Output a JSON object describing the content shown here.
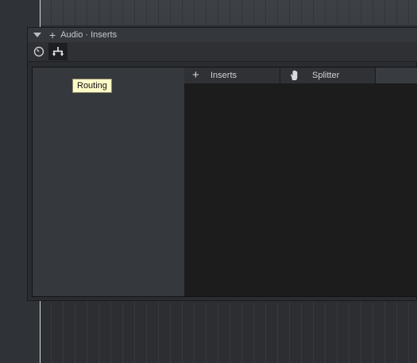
{
  "panel": {
    "title": "Audio · Inserts",
    "collapse_icon": "triangle-down-icon",
    "add_icon": "plus-icon"
  },
  "toolbar": {
    "buttons": [
      {
        "icon": "gauge-icon",
        "active": false
      },
      {
        "icon": "routing-icon",
        "active": true
      }
    ]
  },
  "tooltip": {
    "text": "Routing"
  },
  "chain": {
    "add_symbol": "+",
    "inserts_label": "Inserts",
    "splitter_icon": "hand-icon",
    "splitter_label": "Splitter"
  },
  "colors": {
    "tooltip_bg": "#fffbc8",
    "panel_bg": "#2a2c30",
    "left_pane_bg": "#35383d",
    "right_pane_bg": "#1c1c1d",
    "playhead": "#d8d8d8"
  }
}
